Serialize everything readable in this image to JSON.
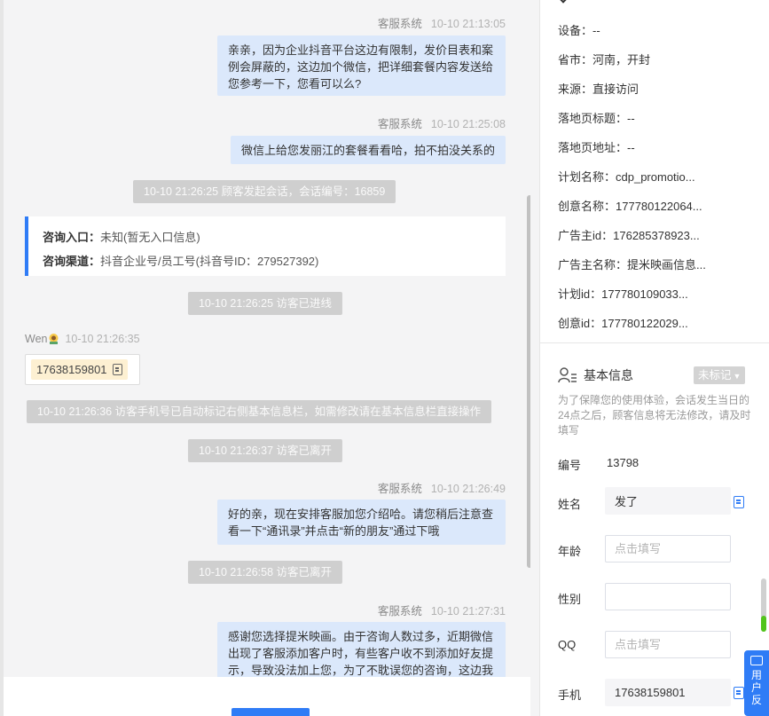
{
  "chat": {
    "messages": [
      {
        "sender": "客服系统",
        "time": "10-10 21:13:05",
        "text": "亲亲，因为企业抖音平台这边有限制，发价目表和案例会屏蔽的，这边加个微信，把详细套餐内容发送给您参考一下，您看可以么?"
      },
      {
        "sender": "客服系统",
        "time": "10-10 21:25:08",
        "text": "微信上给您发丽江的套餐看看哈，拍不拍没关系的"
      },
      {
        "sender": "客服系统",
        "time": "10-10 21:26:49",
        "text": "好的亲，现在安排客服加您介绍哈。请您稍后注意查看一下“通讯录”并点击“新的朋友”通过下哦"
      },
      {
        "sender": "客服系统",
        "time": "10-10 21:27:31",
        "text": "感谢您选择提米映画。由于咨询人数过多，近期微信出现了客服添加客户时，有些客户收不到添加好友提示，导致没法加上您，为了不耽误您的咨询，这边我"
      }
    ],
    "system_notices": {
      "session_start": "10-10 21:26:25 顾客发起会话，会话编号：16859",
      "visitor_joined": "10-10 21:26:25 访客已进线",
      "phone_auto_marked": "10-10 21:26:36 访客手机号已自动标记右侧基本信息栏，如需修改请在基本信息栏直接操作",
      "visitor_left_1": "10-10 21:26:37 访客已离开",
      "visitor_left_2": "10-10 21:26:58 访客已离开"
    },
    "consult_card": {
      "entry_label": "咨询入口：",
      "entry_value": "未知(暂无入口信息)",
      "channel_label": "咨询渠道：",
      "channel_value": "抖音企业号/员工号(抖音号ID：279527392)"
    },
    "visitor_message": {
      "sender": "Wen",
      "time": "10-10 21:26:35",
      "phone": "17638159801"
    }
  },
  "panel": {
    "source_fields": [
      {
        "label": "设备：",
        "value": "--"
      },
      {
        "label": "省市：",
        "value": "河南，开封"
      },
      {
        "label": "来源：",
        "value": "直接访问"
      },
      {
        "label": "落地页标题：",
        "value": "--"
      },
      {
        "label": "落地页地址：",
        "value": "--"
      },
      {
        "label": "计划名称：",
        "value": "cdp_promotio..."
      },
      {
        "label": "创意名称：",
        "value": "177780122064..."
      },
      {
        "label": "广告主id：",
        "value": "176285378923..."
      },
      {
        "label": "广告主名称：",
        "value": "提米映画信息..."
      },
      {
        "label": "计划id：",
        "value": "177780109033..."
      },
      {
        "label": "创意id：",
        "value": "177780122029..."
      }
    ],
    "basic_info": {
      "title": "基本信息",
      "mark_label": "未标记",
      "notice": "为了保障您的使用体验，会话发生当日的24点之后，顾客信息将无法修改，请及时填写",
      "number_label": "编号",
      "number_value": "13798",
      "name_label": "姓名",
      "name_value": "发了",
      "age_label": "年龄",
      "age_placeholder": "点击填写",
      "gender_label": "性别",
      "qq_label": "QQ",
      "qq_placeholder": "点击填写",
      "phone_label": "手机",
      "phone_value": "17638159801"
    },
    "feedback_tab": "用户反"
  },
  "colors": {
    "accent": "#2f7cf6",
    "agent_bubble": "#dbe8fb",
    "system_notice": "#cfcfcf",
    "phone_chip": "#fdf0d2"
  }
}
